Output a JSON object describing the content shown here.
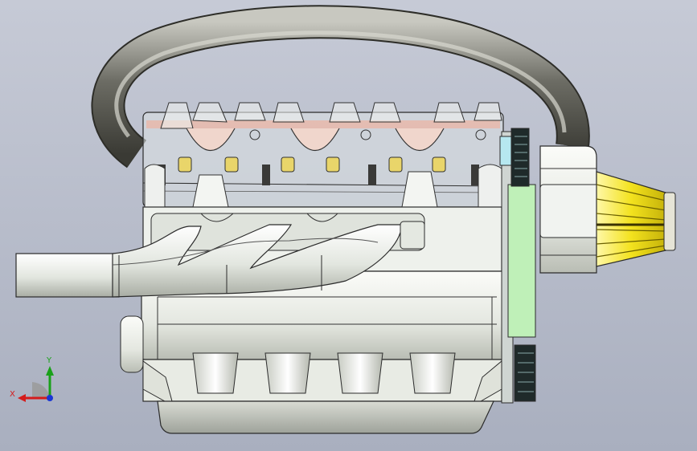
{
  "viewport": {
    "background_top": "#c6cad6",
    "background_bottom": "#a9afbf"
  },
  "model": {
    "part_colors": {
      "metal": "#e9ece6",
      "pipe": "#8a8a80",
      "filter": "#f2e11a",
      "pulley_face": "#bff0b8",
      "belt": "#1f2a2a",
      "gasket": "#e8b7a8"
    }
  },
  "triad": {
    "x_label": "X",
    "y_label": "Y",
    "x_color": "#d41c1c",
    "y_color": "#1aa11a",
    "z_color": "#1a36d4"
  }
}
